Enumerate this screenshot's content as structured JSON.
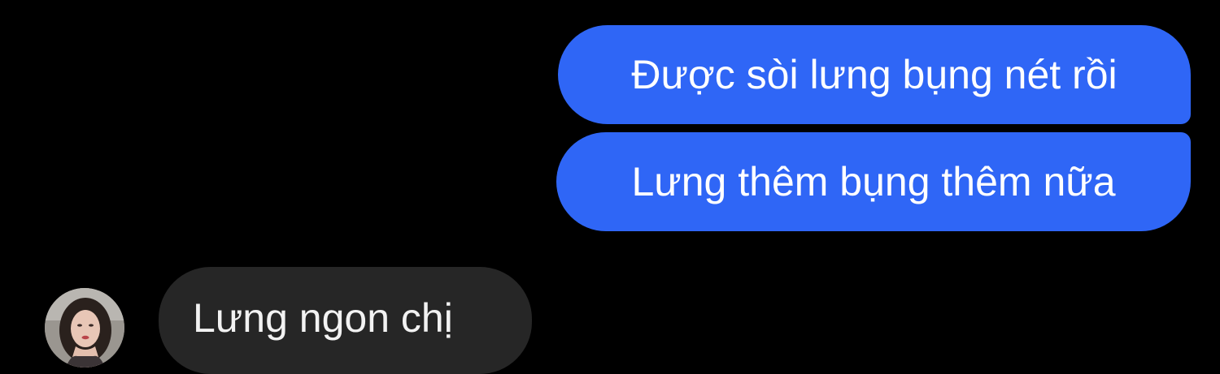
{
  "conversation": {
    "sent_messages": [
      {
        "text": "Được sòi lưng bụng nét rồi"
      },
      {
        "text": "Lưng thêm bụng thêm nữa"
      }
    ],
    "received_messages": [
      {
        "text": "Lưng ngon chị"
      }
    ]
  },
  "colors": {
    "background": "#000000",
    "sent_bubble": "#2f66f6",
    "received_bubble": "#262626",
    "text": "#ffffff"
  },
  "icons": {
    "avatar": "contact-avatar-photo"
  }
}
